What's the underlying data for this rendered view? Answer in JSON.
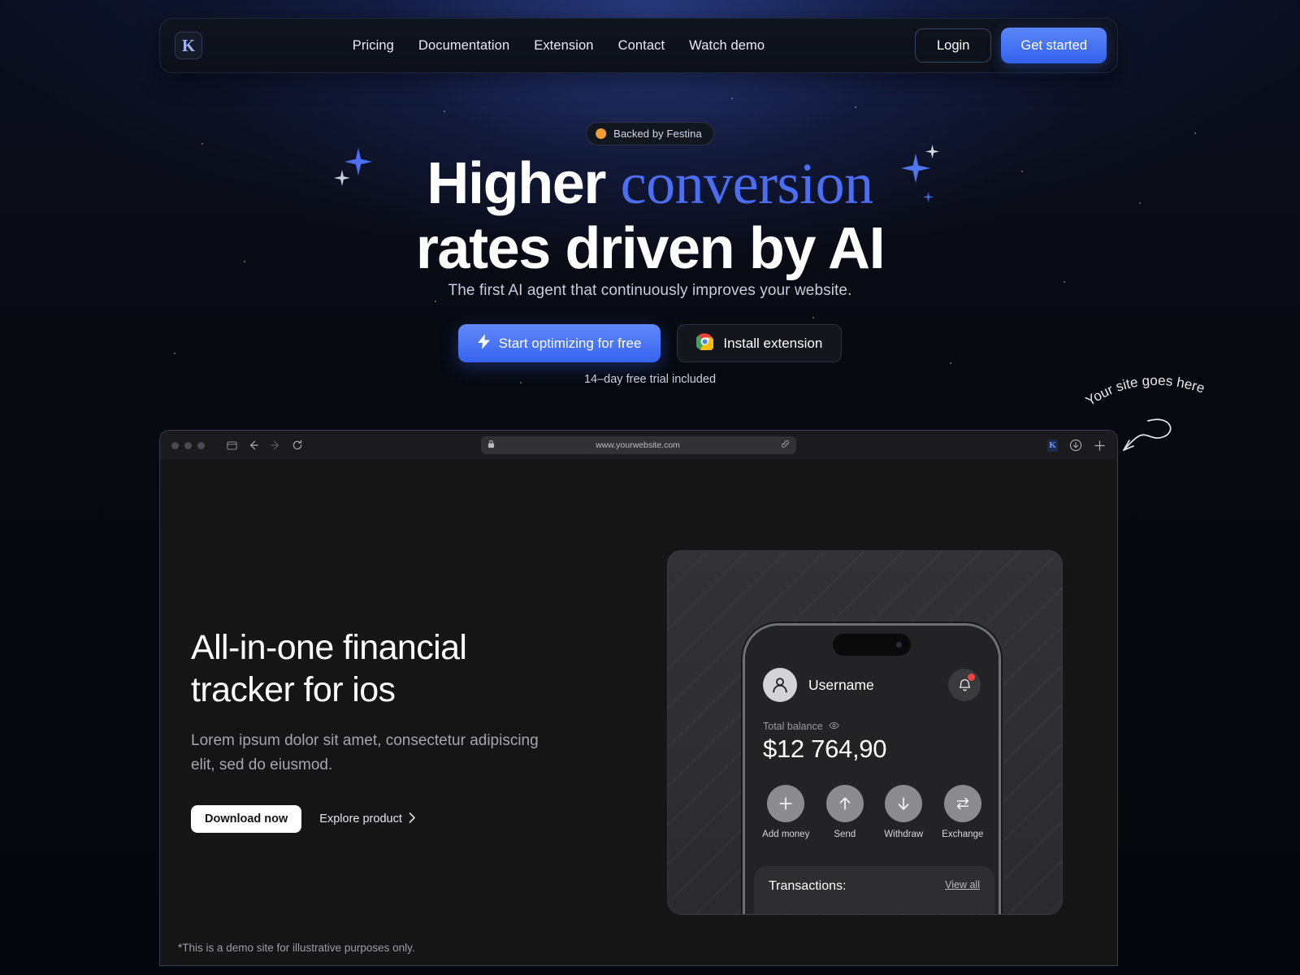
{
  "nav": {
    "logo_letter": "K",
    "links": [
      "Pricing",
      "Documentation",
      "Extension",
      "Contact",
      "Watch demo"
    ],
    "login_label": "Login",
    "get_started_label": "Get started"
  },
  "hero": {
    "badge": {
      "text": "Backed by Festina",
      "dot_color": "#f0a030"
    },
    "headline_part1": "Higher ",
    "headline_emphasis": "conversion",
    "headline_part2": "rates driven by AI",
    "subtitle": "The first AI agent that continuously improves your website.",
    "cta_primary": "Start optimizing for free",
    "cta_secondary": "Install extension",
    "trial_note": "14–day free trial included",
    "accent_color": "#4c6ef5"
  },
  "annotation": {
    "text": "Your site goes here"
  },
  "browser": {
    "url": "www.yourwebsite.com",
    "extension_letter": "K"
  },
  "demo": {
    "title": "All-in-one financial tracker for ios",
    "subtitle": "Lorem ipsum dolor sit amet, consectetur adipiscing elit, sed do eiusmod.",
    "download_label": "Download now",
    "explore_label": "Explore product",
    "disclaimer": "*This is a demo site for illustrative purposes only."
  },
  "phone": {
    "username": "Username",
    "balance_label": "Total balance",
    "balance_value": "$12 764,90",
    "actions": [
      {
        "label": "Add money",
        "icon": "plus-icon"
      },
      {
        "label": "Send",
        "icon": "arrow-up-icon"
      },
      {
        "label": "Withdraw",
        "icon": "arrow-down-icon"
      },
      {
        "label": "Exchange",
        "icon": "exchange-icon"
      }
    ],
    "transactions_title": "Transactions:",
    "view_all_label": "View all"
  }
}
